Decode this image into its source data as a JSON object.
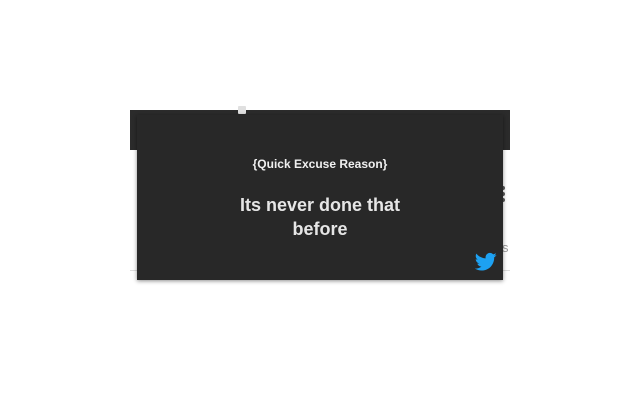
{
  "background": {
    "edge_text": "s"
  },
  "popup": {
    "header": "{Quick Excuse Reason}",
    "message": "Its never done that before",
    "share_icon": "twitter-icon",
    "colors": {
      "background": "#282828",
      "text": "#e6e6e6",
      "twitter_blue": "#1da1f2"
    }
  }
}
